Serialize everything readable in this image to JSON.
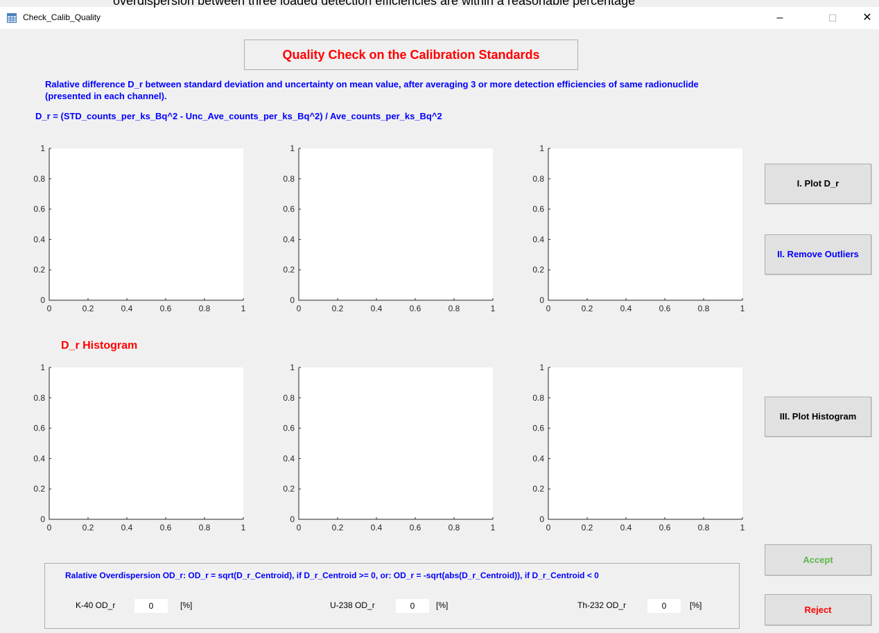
{
  "overflow_text": "overdispersion between three loaded detection efficiencies are within a reasonable percentage",
  "window": {
    "title": "Check_Calib_Quality",
    "minimize": "–",
    "maximize": "☐",
    "close": "✕"
  },
  "header": {
    "title": "Quality Check on the Calibration Standards",
    "description_line1": "Ralative difference D_r between standard deviation and uncertainty on mean value, after averaging 3 or more detection efficiencies of same radionuclide",
    "description_line2": "(presented in each channel).",
    "formula": "D_r = (STD_counts_per_ks_Bq^2  - Unc_Ave_counts_per_ks_Bq^2) / Ave_counts_per_ks_Bq^2"
  },
  "histogram_label": "D_r Histogram",
  "axes": {
    "x_ticks": [
      "0",
      "0.2",
      "0.4",
      "0.6",
      "0.8",
      "1"
    ],
    "y_ticks": [
      "0",
      "0.2",
      "0.4",
      "0.6",
      "0.8",
      "1"
    ]
  },
  "buttons": {
    "plot_dr": "I. Plot D_r",
    "remove_outliers": "II. Remove Outliers",
    "plot_histogram": "III. Plot Histogram",
    "accept": "Accept",
    "reject": "Reject"
  },
  "colors": {
    "blue_text": "#0000ff",
    "red_text": "#ff0000",
    "accept": "#5db54a",
    "reject": "#ff0000"
  },
  "overdispersion": {
    "formula": "Ralative Overdispersion OD_r:   OD_r =  sqrt(D_r_Centroid), if D_r_Centroid >= 0,  or:  OD_r = -sqrt(abs(D_r_Centroid)), if D_r_Centroid < 0",
    "k40_label": "K-40 OD_r",
    "k40_value": "0",
    "u238_label": "U-238 OD_r",
    "u238_value": "0",
    "th232_label": "Th-232 OD_r",
    "th232_value": "0",
    "unit": "[%]"
  }
}
